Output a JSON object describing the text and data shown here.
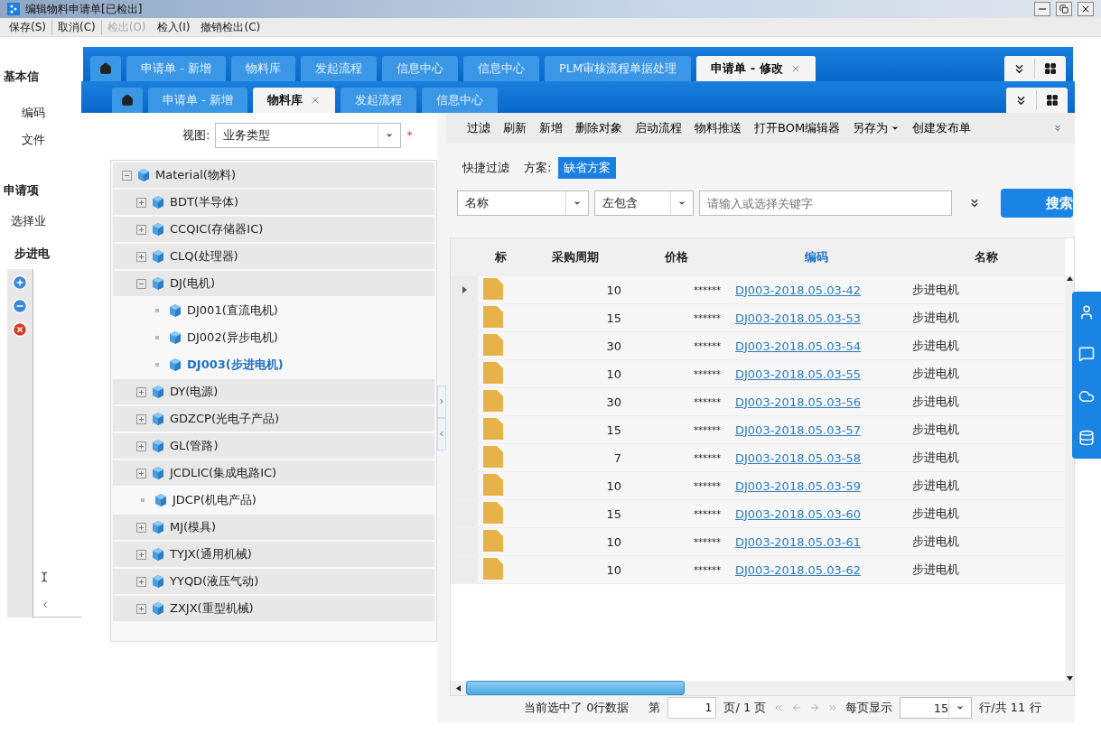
{
  "window": {
    "title": "编辑物料申请单[已检出]"
  },
  "menu": [
    {
      "label": "保存(S)",
      "disabled": false
    },
    {
      "label": "取消(C)",
      "disabled": false
    },
    {
      "label": "检出(O)",
      "disabled": true
    },
    {
      "label": "检入(I)",
      "disabled": false
    },
    {
      "label": "撤销检出(C)",
      "disabled": false
    }
  ],
  "form": {
    "section_1": "基本信",
    "fields": [
      "编码",
      "文件"
    ],
    "section_2": "申请项",
    "select_label": "选择业",
    "grid_title": "步进电"
  },
  "back_tabs": [
    {
      "kind": "home",
      "selected": false
    },
    {
      "kind": "tab",
      "label": "申请单 - 新增",
      "selected": false
    },
    {
      "kind": "tab",
      "label": "物料库",
      "selected": false
    },
    {
      "kind": "tab",
      "label": "发起流程",
      "selected": false
    },
    {
      "kind": "tab",
      "label": "信息中心",
      "selected": false
    },
    {
      "kind": "tab",
      "label": "信息中心",
      "selected": false
    },
    {
      "kind": "tab",
      "label": "PLM审核流程单据处理",
      "selected": false
    },
    {
      "kind": "tab",
      "label": "申请单 - 修改",
      "selected": true
    }
  ],
  "tabs": [
    {
      "kind": "home",
      "selected": false
    },
    {
      "kind": "tab",
      "label": "申请单 - 新增",
      "selected": false
    },
    {
      "kind": "tab",
      "label": "物料库",
      "selected": true
    },
    {
      "kind": "tab",
      "label": "发起流程",
      "selected": false
    },
    {
      "kind": "tab",
      "label": "信息中心",
      "selected": false
    }
  ],
  "view": {
    "label": "视图:",
    "value": "业务类型",
    "required_mark": "*"
  },
  "tree": [
    {
      "label": "Material(物料)",
      "kind": "branch",
      "expanded": true,
      "selected": false,
      "children": [
        {
          "label": "BDT(半导体)",
          "kind": "branch",
          "expanded": false,
          "selected": false
        },
        {
          "label": "CCQIC(存储器IC)",
          "kind": "branch",
          "expanded": false,
          "selected": false
        },
        {
          "label": "CLQ(处理器)",
          "kind": "branch",
          "expanded": false,
          "selected": false
        },
        {
          "label": "DJ(电机)",
          "kind": "branch",
          "expanded": true,
          "selected": false,
          "children": [
            {
              "label": "DJ001(直流电机)",
              "kind": "leaf",
              "selected": false
            },
            {
              "label": "DJ002(异步电机)",
              "kind": "leaf",
              "selected": false
            },
            {
              "label": "DJ003(步进电机)",
              "kind": "leaf",
              "selected": true
            }
          ]
        },
        {
          "label": "DY(电源)",
          "kind": "branch",
          "expanded": false,
          "selected": false
        },
        {
          "label": "GDZCP(光电子产品)",
          "kind": "branch",
          "expanded": false,
          "selected": false
        },
        {
          "label": "GL(管路)",
          "kind": "branch",
          "expanded": false,
          "selected": false
        },
        {
          "label": "JCDLIC(集成电路IC)",
          "kind": "branch",
          "expanded": false,
          "selected": false
        },
        {
          "label": "JDCP(机电产品)",
          "kind": "leaf",
          "selected": false
        },
        {
          "label": "MJ(模具)",
          "kind": "branch",
          "expanded": false,
          "selected": false
        },
        {
          "label": "TYJX(通用机械)",
          "kind": "branch",
          "expanded": false,
          "selected": false
        },
        {
          "label": "YYQD(液压气动)",
          "kind": "branch",
          "expanded": false,
          "selected": false
        },
        {
          "label": "ZXJX(重型机械)",
          "kind": "branch",
          "expanded": false,
          "selected": false
        }
      ]
    }
  ],
  "toolbar": [
    {
      "label": "过滤",
      "kind": "button"
    },
    {
      "label": "刷新",
      "kind": "button"
    },
    {
      "label": "新增",
      "kind": "button"
    },
    {
      "label": "删除对象",
      "kind": "button"
    },
    {
      "label": "启动流程",
      "kind": "button"
    },
    {
      "label": "物料推送",
      "kind": "button"
    },
    {
      "label": "打开BOM编辑器",
      "kind": "button"
    },
    {
      "label": "另存为",
      "kind": "dropdown"
    },
    {
      "label": "创建发布单",
      "kind": "button"
    }
  ],
  "quick_filter": {
    "label": "快捷过滤",
    "scheme_label": "方案:",
    "scheme": "缺省方案"
  },
  "search": {
    "field": "名称",
    "operator": "左包含",
    "placeholder": "请输入或选择关键字",
    "button": "搜索"
  },
  "table": {
    "columns": [
      {
        "label": "标",
        "highlighted": false
      },
      {
        "label": "采购周期",
        "highlighted": false
      },
      {
        "label": "价格",
        "highlighted": false
      },
      {
        "label": "编码",
        "highlighted": true
      },
      {
        "label": "名称",
        "highlighted": false
      }
    ],
    "rows": [
      {
        "selected": true,
        "cycle": "10",
        "price": "******",
        "code": "DJ003-2018.05.03-42",
        "name": "步进电机"
      },
      {
        "selected": false,
        "cycle": "15",
        "price": "******",
        "code": "DJ003-2018.05.03-53",
        "name": "步进电机"
      },
      {
        "selected": false,
        "cycle": "30",
        "price": "******",
        "code": "DJ003-2018.05.03-54",
        "name": "步进电机"
      },
      {
        "selected": false,
        "cycle": "10",
        "price": "******",
        "code": "DJ003-2018.05.03-55",
        "name": "步进电机"
      },
      {
        "selected": false,
        "cycle": "30",
        "price": "******",
        "code": "DJ003-2018.05.03-56",
        "name": "步进电机"
      },
      {
        "selected": false,
        "cycle": "15",
        "price": "******",
        "code": "DJ003-2018.05.03-57",
        "name": "步进电机"
      },
      {
        "selected": false,
        "cycle": "7",
        "price": "******",
        "code": "DJ003-2018.05.03-58",
        "name": "步进电机"
      },
      {
        "selected": false,
        "cycle": "10",
        "price": "******",
        "code": "DJ003-2018.05.03-59",
        "name": "步进电机"
      },
      {
        "selected": false,
        "cycle": "15",
        "price": "******",
        "code": "DJ003-2018.05.03-60",
        "name": "步进电机"
      },
      {
        "selected": false,
        "cycle": "10",
        "price": "******",
        "code": "DJ003-2018.05.03-61",
        "name": "步进电机"
      },
      {
        "selected": false,
        "cycle": "10",
        "price": "******",
        "code": "DJ003-2018.05.03-62",
        "name": "步进电机"
      }
    ]
  },
  "pager": {
    "selection": "当前选中了 0行数据",
    "page_prefix": "第",
    "page": "1",
    "page_suffix": "页/ 1 页",
    "per_page_label": "每页显示",
    "per_page": "15",
    "total": "行/共 11 行"
  }
}
